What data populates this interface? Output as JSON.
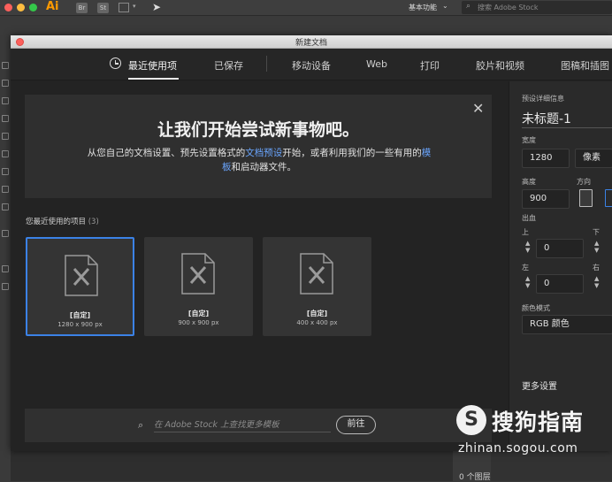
{
  "app": {
    "logo": "Ai",
    "bridge_icon": "Br",
    "stock_icon": "St",
    "workspace_label": "基本功能",
    "stock_search_placeholder": "搜索 Adobe Stock",
    "layer_count": "0 个图层"
  },
  "dialog": {
    "title": "新建文档",
    "tabs": [
      "最近使用项",
      "已保存",
      "移动设备",
      "Web",
      "打印",
      "胶片和视频",
      "图稿和插图"
    ],
    "active_tab": 0
  },
  "banner": {
    "title": "让我们开始尝试新事物吧。",
    "text_1": "从您自己的文档设置、预先设置格式的",
    "link_1": "文档预设",
    "text_2": "开始，或者利用我们的一些有用的",
    "link_2": "模板",
    "text_3": "和启动器文件。"
  },
  "recent": {
    "label": "您最近使用的项目",
    "count": "(3)",
    "items": [
      {
        "name": "[自定]",
        "size": "1280 x 900 px"
      },
      {
        "name": "[自定]",
        "size": "900 x 900 px"
      },
      {
        "name": "[自定]",
        "size": "400 x 400 px"
      }
    ]
  },
  "stock_bar": {
    "placeholder": "在 Adobe Stock 上查找更多模板",
    "go_label": "前往"
  },
  "preset": {
    "section_label": "预设详细信息",
    "name": "未标题-1",
    "width_label": "宽度",
    "width_value": "1280",
    "unit": "像素",
    "height_label": "高度",
    "height_value": "900",
    "orientation_label": "方向",
    "bleed_label": "出血",
    "top_label": "上",
    "top_value": "0",
    "bottom_label": "下",
    "left_label": "左",
    "left_value": "0",
    "right_label": "右",
    "color_mode_label": "颜色模式",
    "color_mode_value": "RGB 颜色",
    "more_settings": "更多设置"
  },
  "watermark": {
    "logo": "S",
    "text": "搜狗指南",
    "url": "zhinan.sogou.com"
  },
  "colors": {
    "accent": "#3b82e6",
    "link": "#6aa6ff",
    "ai_orange": "#ff9a00"
  }
}
